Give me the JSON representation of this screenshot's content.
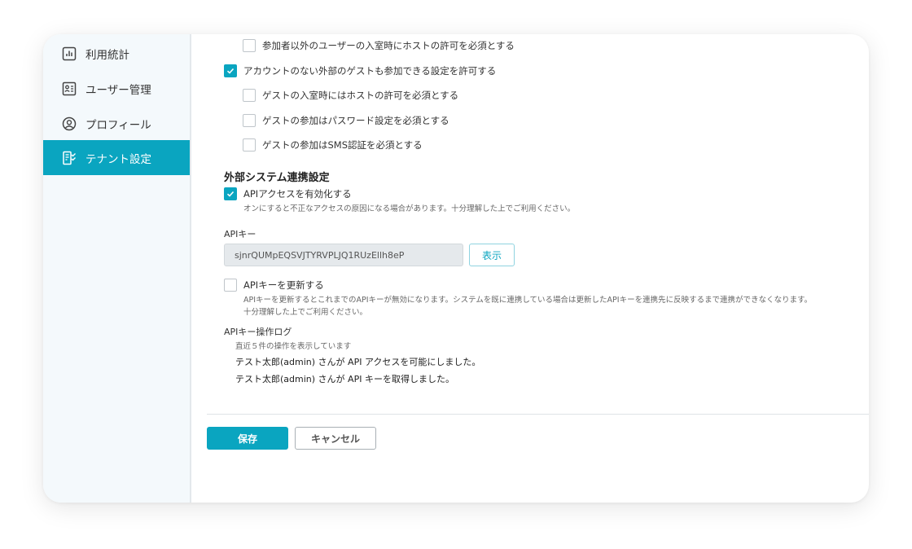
{
  "sidebar": {
    "items": [
      {
        "label": "利用統計",
        "icon": "bar-chart-icon"
      },
      {
        "label": "ユーザー管理",
        "icon": "id-card-icon"
      },
      {
        "label": "プロフィール",
        "icon": "user-circle-icon"
      },
      {
        "label": "テナント設定",
        "icon": "tenant-settings-icon",
        "active": true
      }
    ]
  },
  "settings": {
    "require_host_permission_non_participant": {
      "label": "参加者以外のユーザーの入室時にホストの許可を必須とする",
      "checked": false
    },
    "allow_external_guests": {
      "label": "アカウントのない外部のゲストも参加できる設定を許可する",
      "checked": true
    },
    "guest_require_host_permission": {
      "label": "ゲストの入室時にはホストの許可を必須とする",
      "checked": false
    },
    "guest_require_password": {
      "label": "ゲストの参加はパスワード設定を必須とする",
      "checked": false
    },
    "guest_require_sms": {
      "label": "ゲストの参加はSMS認証を必須とする",
      "checked": false
    }
  },
  "external_system": {
    "heading": "外部システム連携設定",
    "enable_api": {
      "label": "APIアクセスを有効化する",
      "checked": true
    },
    "enable_api_note": "オンにすると不正なアクセスの原因になる場合があります。十分理解した上でご利用ください。",
    "api_key_label": "APIキー",
    "api_key_value": "sjnrQUMpEQSVJTYRVPLJQ1RUzEllh8eP",
    "show_button": "表示",
    "renew_key": {
      "label": "APIキーを更新する",
      "checked": false
    },
    "renew_note_1": "APIキーを更新するとこれまでのAPIキーが無効になります。システムを既に連携している場合は更新したAPIキーを連携先に反映するまで連携ができなくなります。",
    "renew_note_2": "十分理解した上でご利用ください。",
    "log_heading": "APIキー操作ログ",
    "log_note": "直近５件の操作を表示しています",
    "log_entries": [
      "テスト太郎(admin) さんが API アクセスを可能にしました。",
      "テスト太郎(admin) さんが API キーを取得しました。"
    ]
  },
  "actions": {
    "save": "保存",
    "cancel": "キャンセル"
  },
  "colors": {
    "accent": "#0aa5c0",
    "sidebar_bg": "#f4f9fc"
  }
}
